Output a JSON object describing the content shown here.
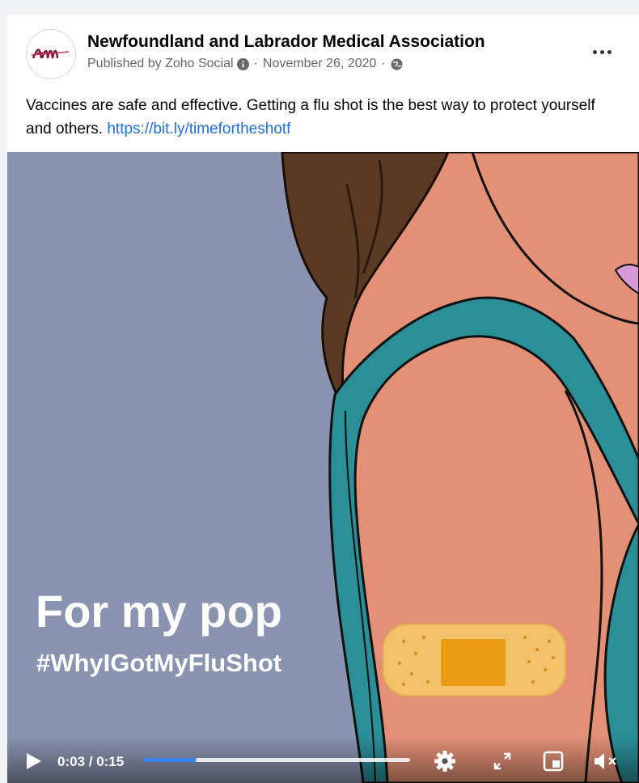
{
  "post": {
    "page_name": "Newfoundland and Labrador Medical Association",
    "published_by": "Published by Zoho Social",
    "separator": "·",
    "date": "November 26, 2020",
    "separator2": "·",
    "text": "Vaccines are safe and effective. Getting a flu shot is the best way to protect yourself and others. ",
    "link": "https://bit.ly/timefortheshotf",
    "avatar_logo_text": "NLMA"
  },
  "icons": {
    "more": "more-options-icon",
    "info": "info-icon",
    "audience": "globe-icon",
    "play": "play-icon",
    "settings": "gear-icon",
    "fullscreen": "fullscreen-icon",
    "pip": "picture-in-picture-icon",
    "mute": "muted-speaker-icon"
  },
  "video": {
    "overlay_title": "For my pop",
    "overlay_hashtag": "#WhyIGotMyFluShot",
    "time": "0:03 / 0:15",
    "progress": 0.2
  },
  "colors": {
    "link": "#216fdb",
    "background": "#8a94b1",
    "skin": "#e39076",
    "top": "#2a8f97",
    "hair": "#5a3a22",
    "bandage": "#f2c26b",
    "bandage_pad": "#e99a12",
    "progress": "#3b82f0"
  }
}
